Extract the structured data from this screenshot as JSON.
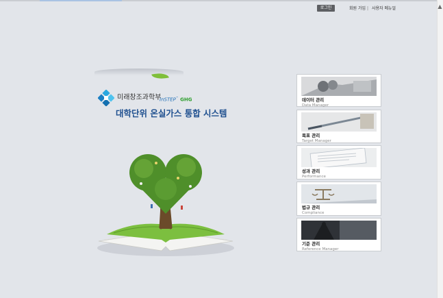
{
  "header": {
    "login_label": "로그인",
    "signup_label": "회원 가입",
    "separator": "|",
    "manual_label": "사용자 메뉴얼"
  },
  "brand": {
    "ministry_name": "미래창조과학부",
    "partner_logo_text": "InSTEP",
    "partner_logo_suffix": "GHG",
    "system_title": "대학단위 온실가스 통합 시스템"
  },
  "menu": [
    {
      "title": "데이터 관리",
      "subtitle": "Data Manager",
      "icon": "data-manager-image"
    },
    {
      "title": "목표 관리",
      "subtitle": "Target Manager",
      "icon": "target-manager-image"
    },
    {
      "title": "성과 관리",
      "subtitle": "Performance",
      "icon": "performance-image"
    },
    {
      "title": "법규 관리",
      "subtitle": "Compliance",
      "icon": "compliance-image"
    },
    {
      "title": "기준 관리",
      "subtitle": "Reference Manager",
      "icon": "reference-manager-image"
    }
  ],
  "colors": {
    "background": "#e2e5ea",
    "title_blue": "#1e4f8f",
    "login_button": "#5d5f63",
    "tree_green": "#5a9a2e"
  }
}
